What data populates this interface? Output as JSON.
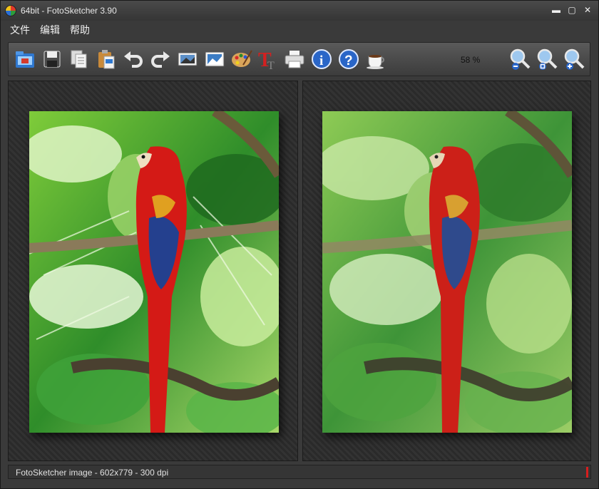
{
  "window": {
    "title": "64bit - FotoSketcher 3.90"
  },
  "window_controls": {
    "minimize": "▬",
    "maximize": "▢",
    "close": "✕"
  },
  "menu": {
    "items": [
      "文件",
      "编辑",
      "帮助"
    ]
  },
  "toolbar": {
    "buttons": [
      {
        "icon": "open-folder-icon"
      },
      {
        "icon": "save-icon"
      },
      {
        "icon": "copy-icon"
      },
      {
        "icon": "paste-icon"
      },
      {
        "icon": "undo-icon"
      },
      {
        "icon": "redo-icon"
      },
      {
        "icon": "batch-icon"
      },
      {
        "icon": "image-frame-icon"
      },
      {
        "icon": "palette-icon"
      },
      {
        "icon": "text-icon"
      },
      {
        "icon": "print-icon"
      },
      {
        "icon": "info-icon"
      },
      {
        "icon": "help-icon"
      },
      {
        "icon": "coffee-icon"
      },
      {
        "icon": "zoom-out-icon"
      },
      {
        "icon": "zoom-fit-icon"
      },
      {
        "icon": "zoom-in-icon"
      }
    ],
    "zoom_level": "58 %"
  },
  "status": {
    "text": "FotoSketcher image - 602x779 - 300 dpi",
    "indicator_color": "#d81e1e"
  }
}
